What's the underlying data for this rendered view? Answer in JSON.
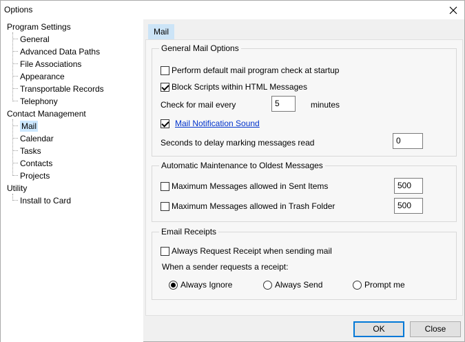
{
  "window": {
    "title": "Options"
  },
  "tree": {
    "groups": [
      {
        "label": "Program Settings",
        "children": [
          "General",
          "Advanced Data Paths",
          "File Associations",
          "Appearance",
          "Transportable Records",
          "Telephony"
        ]
      },
      {
        "label": "Contact Management",
        "children": [
          "Mail",
          "Calendar",
          "Tasks",
          "Contacts",
          "Projects"
        ]
      },
      {
        "label": "Utility",
        "children": [
          "Install to Card"
        ]
      }
    ],
    "selected": "Mail"
  },
  "tab": {
    "label": "Mail"
  },
  "general": {
    "title": "General Mail Options",
    "default_check": {
      "label": "Perform default mail program check at startup",
      "checked": false
    },
    "block_scripts": {
      "label": "Block Scripts within HTML Messages",
      "checked": true
    },
    "check_every_label": "Check for mail every",
    "check_every_value": "5",
    "minutes_label": "minutes",
    "notification": {
      "label": "Mail Notification Sound",
      "checked": true
    },
    "delay_label": "Seconds to delay marking messages read",
    "delay_value": "0"
  },
  "maintenance": {
    "title": "Automatic Maintenance to Oldest Messages",
    "sent": {
      "label": "Maximum Messages allowed in Sent Items",
      "checked": false,
      "value": "500"
    },
    "trash": {
      "label": "Maximum Messages allowed in Trash Folder",
      "checked": false,
      "value": "500"
    }
  },
  "receipts": {
    "title": "Email Receipts",
    "always_request": {
      "label": "Always Request Receipt when sending mail",
      "checked": false
    },
    "sender_label": "When a sender requests a receipt:",
    "options": [
      "Always Ignore",
      "Always Send",
      "Prompt me"
    ],
    "selected": "Always Ignore"
  },
  "buttons": {
    "ok": "OK",
    "close": "Close"
  }
}
